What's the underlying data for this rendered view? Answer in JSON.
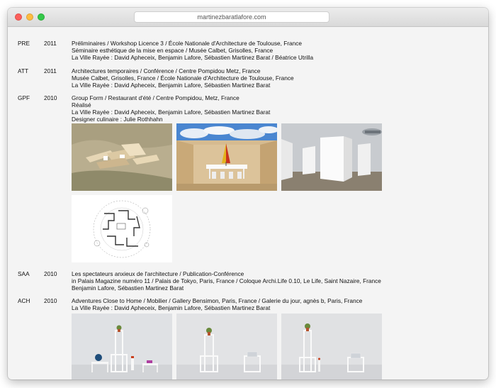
{
  "browser": {
    "url": "martinezbaratlafore.com"
  },
  "entries": [
    {
      "code": "PRE",
      "year": "2011",
      "lines": [
        "Préliminaires / Workshop Licence 3 / École Nationale d'Architecture de Toulouse, France",
        "Séminaire esthétique de la mise en espace / Musée Calbet, Grisolles, France",
        "La Ville Rayée : David Apheceix, Benjamin Lafore, Sébastien Martinez Barat / Béatrice Utrilla"
      ]
    },
    {
      "code": "ATT",
      "year": "2011",
      "lines": [
        "Architectures temporaires / Conférence / Centre Pompidou Metz, France",
        "Musée Calbet, Grisolles, France / École Nationale d'Architecture de Toulouse, France",
        "La Ville Rayée : David Apheceix, Benjamin Lafore, Sébastien Martinez Barat"
      ]
    },
    {
      "code": "GPF",
      "year": "2010",
      "lines": [
        "Group Form / Restaurant d'été / Centre Pompidou, Metz, France",
        "Réalisé",
        "La Ville Rayée : David Apheceix, Benjamin Lafore, Sébastien Martinez Barat",
        "Designer culinaire : Julie Rothhahn"
      ]
    },
    {
      "code": "SAA",
      "year": "2010",
      "lines": [
        "Les spectateurs anxieux de l'architecture / Publication-Conférence",
        "in Palais Magazine numéro 11 / Palais de Tokyo, Paris, France / Coloque Archi.Life 0.10, Le Life, Saint Nazaire, France",
        "Benjamin Lafore, Sébastien Martinez Barat"
      ]
    },
    {
      "code": "ACH",
      "year": "2010",
      "lines": [
        "Adventures Close to Home / Mobilier / Gallery Bensimon, Paris, France / Galerie du jour, agnès b, Paris, France",
        "La Ville Rayée : David Apheceix, Benjamin Lafore, Sébastien Martinez Barat"
      ]
    }
  ],
  "images": {
    "gpf": [
      {
        "name": "gpf-aerial-photo",
        "subject": "aerial view of wooden pavilion in a field"
      },
      {
        "name": "gpf-interior-photo",
        "subject": "wooden enclosure with table and yellow-red umbrella under blue sky"
      },
      {
        "name": "gpf-white-walls-photo",
        "subject": "white walls pavilion at dusk"
      },
      {
        "name": "gpf-plan-drawing",
        "subject": "architectural plan drawing"
      }
    ],
    "ach": [
      {
        "name": "ach-furniture-photo-1",
        "subject": "white furniture with plant, globe and laptop"
      },
      {
        "name": "ach-furniture-photo-2",
        "subject": "white furniture tower with plant and laptop"
      },
      {
        "name": "ach-furniture-photo-3",
        "subject": "white furniture tower with plant, lamp and laptop"
      }
    ]
  }
}
